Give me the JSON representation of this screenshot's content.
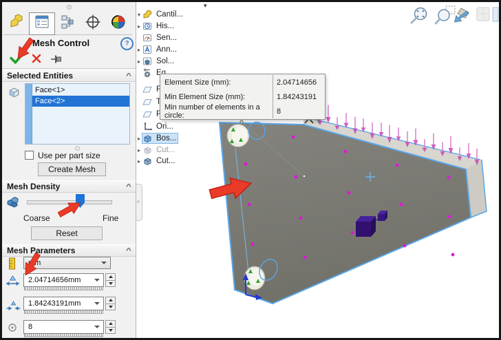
{
  "ui": {
    "chevron": "^",
    "help_glyph": "?",
    "tree_collapse_glyph": "▾",
    "colors": {
      "accent_blue": "#2174d4",
      "edge_highlight_blue": "#58a6e8",
      "annotation_red": "#ea3b28",
      "mesh_point_magenta": "#e414de",
      "load_arrow_pink": "#c648ba",
      "check_green": "#21a32b",
      "cancel_red": "#e23427"
    }
  },
  "panel": {
    "title": "Mesh Control",
    "tabs": [
      {
        "icon": "featuremanager-tab-icon",
        "active": false
      },
      {
        "icon": "propertymanager-tab-icon",
        "active": true
      },
      {
        "icon": "configurationmanager-tab-icon",
        "active": false
      },
      {
        "icon": "dimxpertmanager-tab-icon",
        "active": false
      },
      {
        "icon": "displaymanager-tab-icon",
        "active": false
      }
    ],
    "action_icons": [
      "ok-check-icon",
      "cancel-x-icon",
      "pin-icon"
    ],
    "selected_entities": {
      "title": "Selected Entities",
      "items": [
        {
          "label": "Face<1>",
          "selected": false
        },
        {
          "label": "Face<2>",
          "selected": true
        }
      ]
    },
    "use_per_part_size_label": "Use per part size",
    "use_per_part_size_checked": false,
    "create_mesh_label": "Create Mesh",
    "mesh_density": {
      "title": "Mesh Density",
      "coarse_label": "Coarse",
      "fine_label": "Fine",
      "reset_label": "Reset",
      "slider_position_pct": 62
    },
    "mesh_parameters": {
      "title": "Mesh Parameters",
      "unit": "mm",
      "element_size": "2.04714656mm",
      "min_element_size": "1.84243191mm",
      "min_elements_in_circle": "8"
    }
  },
  "tree": {
    "items": [
      {
        "label": "Cantil...",
        "expander": "▾",
        "icon": "part-icon"
      },
      {
        "label": "His...",
        "expander": "▸",
        "icon": "history-folder-icon"
      },
      {
        "label": "Sen...",
        "expander": "",
        "icon": "sensors-folder-icon"
      },
      {
        "label": "Ann...",
        "expander": "▸",
        "icon": "annotations-folder-icon"
      },
      {
        "label": "Sol...",
        "expander": "▸",
        "icon": "solid-bodies-folder-icon"
      },
      {
        "label": "Eq",
        "expander": "",
        "icon": "equations-folder-icon"
      },
      {
        "label": "F",
        "expander": "",
        "icon": "plane-icon"
      },
      {
        "label": "T",
        "expander": "",
        "icon": "plane-icon"
      },
      {
        "label": "R",
        "expander": "",
        "icon": "plane-icon"
      },
      {
        "label": "Ori...",
        "expander": "",
        "icon": "origin-icon"
      },
      {
        "label": "Bos...",
        "expander": "▸",
        "icon": "boss-extrude-icon",
        "selected": true
      },
      {
        "label": "Cut...",
        "expander": "▸",
        "icon": "cut-extrude-icon",
        "dimmed": true
      },
      {
        "label": "Cut...",
        "expander": "▸",
        "icon": "cut-extrude-icon"
      }
    ]
  },
  "tooltip": {
    "rows": [
      {
        "label": "Element Size (mm):",
        "value": "2.04714656"
      },
      {
        "label": "Min Element Size (mm):",
        "value": "1.84243191"
      },
      {
        "label": "Min number of elements in a circle:",
        "value": "8"
      }
    ]
  },
  "viewport": {
    "toolbar": [
      {
        "icon": "zoom-to-fit-icon"
      },
      {
        "icon": "zoom-to-area-icon"
      },
      {
        "icon": "previous-view-icon"
      },
      {
        "icon": "section-view-icon"
      },
      {
        "icon": "view-settings-icon"
      }
    ]
  }
}
